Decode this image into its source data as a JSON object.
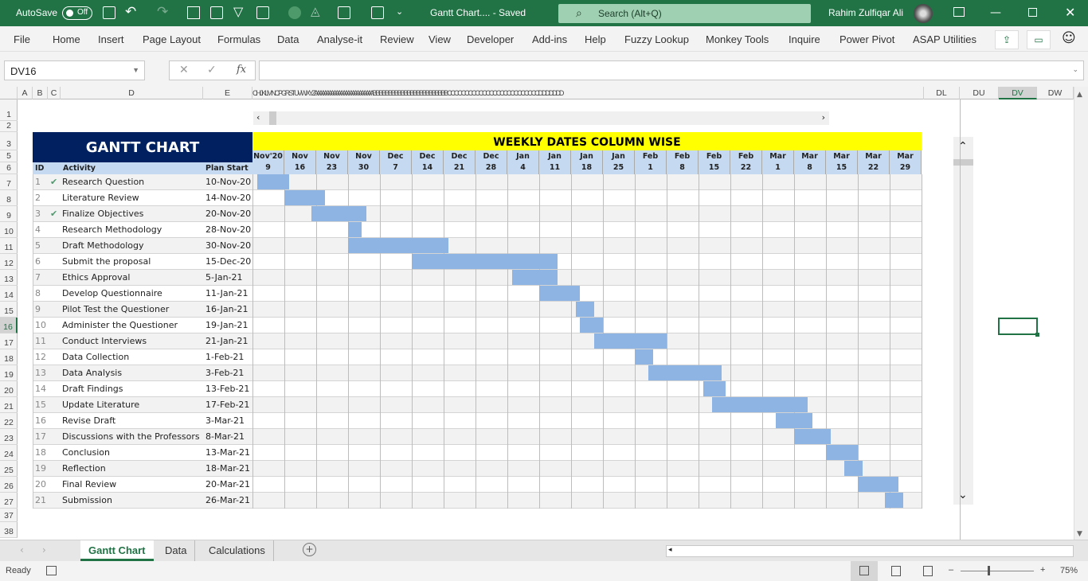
{
  "titlebar": {
    "autosave_label": "AutoSave",
    "autosave_state": "Off",
    "doc_title": "Gantt Chart....  -  Saved",
    "search_placeholder": "Search (Alt+Q)",
    "user": "Rahim Zulfiqar Ali"
  },
  "menu": [
    "File",
    "Home",
    "Insert",
    "Page Layout",
    "Formulas",
    "Data",
    "Analyse-it",
    "Review",
    "View",
    "Developer",
    "Add-ins",
    "Help",
    "Fuzzy Lookup",
    "Monkey Tools",
    "Inquire",
    "Power Pivot",
    "ASAP Utilities"
  ],
  "formula_bar": {
    "name_box": "DV16",
    "formula": ""
  },
  "columns": {
    "A": "A",
    "B": "B",
    "C": "C",
    "D": "D",
    "E": "E",
    "compressed": "CH I J K L M N C P G R S T U V W X Y Z A A A A A A A A A A A A A A A A A A A A A A A A A B B B B B B B B B B B B B B B B B B B B B B B B C C C C C C C C C C C C C C C C C C C C C C C C C C D D D D D D D",
    "DL": "DL",
    "DU": "DU",
    "DV": "DV",
    "DW": "DW"
  },
  "rows": [
    "1",
    "2",
    "3",
    "5",
    "6",
    "7",
    "8",
    "9",
    "10",
    "11",
    "12",
    "13",
    "14",
    "15",
    "16",
    "17",
    "18",
    "19",
    "20",
    "21",
    "22",
    "23",
    "24",
    "25",
    "26",
    "27",
    "37",
    "38"
  ],
  "selected_row": "16",
  "gantt": {
    "title": "GANTT CHART",
    "weekly_title": "WEEKLY DATES COLUMN WISE",
    "headers": {
      "id": "ID",
      "activity": "Activity",
      "plan_start": "Plan Start"
    },
    "timeline_start": "2020-11-09",
    "weeks": [
      [
        "Nov'20",
        "9"
      ],
      [
        "Nov",
        "16"
      ],
      [
        "Nov",
        "23"
      ],
      [
        "Nov",
        "30"
      ],
      [
        "Dec",
        "7"
      ],
      [
        "Dec",
        "14"
      ],
      [
        "Dec",
        "21"
      ],
      [
        "Dec",
        "28"
      ],
      [
        "Jan",
        "4"
      ],
      [
        "Jan",
        "11"
      ],
      [
        "Jan",
        "18"
      ],
      [
        "Jan",
        "25"
      ],
      [
        "Feb",
        "1"
      ],
      [
        "Feb",
        "8"
      ],
      [
        "Feb",
        "15"
      ],
      [
        "Feb",
        "22"
      ],
      [
        "Mar",
        "1"
      ],
      [
        "Mar",
        "8"
      ],
      [
        "Mar",
        "15"
      ],
      [
        "Mar",
        "22"
      ],
      [
        "Mar",
        "29"
      ]
    ],
    "tasks": [
      {
        "id": "1",
        "done": true,
        "activity": "Research Question",
        "plan_start": "10-Nov-20",
        "bar_start": "2020-11-10",
        "bar_end": "2020-11-17"
      },
      {
        "id": "2",
        "done": false,
        "activity": "Literature Review",
        "plan_start": "14-Nov-20",
        "bar_start": "2020-11-16",
        "bar_end": "2020-11-25"
      },
      {
        "id": "3",
        "done": true,
        "activity": "Finalize Objectives",
        "plan_start": "20-Nov-20",
        "bar_start": "2020-11-22",
        "bar_end": "2020-12-04"
      },
      {
        "id": "4",
        "done": false,
        "activity": "Research Methodology",
        "plan_start": "28-Nov-20",
        "bar_start": "2020-11-30",
        "bar_end": "2020-12-03"
      },
      {
        "id": "5",
        "done": false,
        "activity": "Draft Methodology",
        "plan_start": "30-Nov-20",
        "bar_start": "2020-11-30",
        "bar_end": "2020-12-22"
      },
      {
        "id": "6",
        "done": false,
        "activity": "Submit the proposal",
        "plan_start": "15-Dec-20",
        "bar_start": "2020-12-14",
        "bar_end": "2021-01-15"
      },
      {
        "id": "7",
        "done": false,
        "activity": "Ethics Approval",
        "plan_start": "5-Jan-21",
        "bar_start": "2021-01-05",
        "bar_end": "2021-01-15"
      },
      {
        "id": "8",
        "done": false,
        "activity": "Develop Questionnaire",
        "plan_start": "11-Jan-21",
        "bar_start": "2021-01-11",
        "bar_end": "2021-01-20"
      },
      {
        "id": "9",
        "done": false,
        "activity": "Pilot Test the Questioner",
        "plan_start": "16-Jan-21",
        "bar_start": "2021-01-19",
        "bar_end": "2021-01-23"
      },
      {
        "id": "10",
        "done": false,
        "activity": "Administer the Questioner",
        "plan_start": "19-Jan-21",
        "bar_start": "2021-01-20",
        "bar_end": "2021-01-25"
      },
      {
        "id": "11",
        "done": false,
        "activity": "Conduct Interviews",
        "plan_start": "21-Jan-21",
        "bar_start": "2021-01-23",
        "bar_end": "2021-02-08"
      },
      {
        "id": "12",
        "done": false,
        "activity": "Data Collection",
        "plan_start": "1-Feb-21",
        "bar_start": "2021-02-01",
        "bar_end": "2021-02-05"
      },
      {
        "id": "13",
        "done": false,
        "activity": "Data Analysis",
        "plan_start": "3-Feb-21",
        "bar_start": "2021-02-04",
        "bar_end": "2021-02-20"
      },
      {
        "id": "14",
        "done": false,
        "activity": "Draft Findings",
        "plan_start": "13-Feb-21",
        "bar_start": "2021-02-16",
        "bar_end": "2021-02-21"
      },
      {
        "id": "15",
        "done": false,
        "activity": "Update Literature",
        "plan_start": "17-Feb-21",
        "bar_start": "2021-02-18",
        "bar_end": "2021-03-11"
      },
      {
        "id": "16",
        "done": false,
        "activity": "Revise Draft",
        "plan_start": "3-Mar-21",
        "bar_start": "2021-03-04",
        "bar_end": "2021-03-12"
      },
      {
        "id": "17",
        "done": false,
        "activity": "Discussions with the Professors",
        "plan_start": "8-Mar-21",
        "bar_start": "2021-03-08",
        "bar_end": "2021-03-16"
      },
      {
        "id": "18",
        "done": false,
        "activity": "Conclusion",
        "plan_start": "13-Mar-21",
        "bar_start": "2021-03-15",
        "bar_end": "2021-03-22"
      },
      {
        "id": "19",
        "done": false,
        "activity": "Reflection",
        "plan_start": "18-Mar-21",
        "bar_start": "2021-03-19",
        "bar_end": "2021-03-23"
      },
      {
        "id": "20",
        "done": false,
        "activity": "Final Review",
        "plan_start": "20-Mar-21",
        "bar_start": "2021-03-22",
        "bar_end": "2021-03-31"
      },
      {
        "id": "21",
        "done": false,
        "activity": "Submission",
        "plan_start": "26-Mar-21",
        "bar_start": "2021-03-28",
        "bar_end": "2021-04-01"
      }
    ],
    "colors": {
      "title_bg": "#002060",
      "weekly_bg": "#ffff00",
      "header_bg": "#c5d9f1",
      "bar": "#8eb4e3",
      "check": "#4e9a6e"
    }
  },
  "sheets": {
    "tabs": [
      "Gantt Chart",
      "Data",
      "Calculations"
    ],
    "active": "Gantt Chart"
  },
  "status": {
    "ready": "Ready",
    "zoom": "75%"
  }
}
